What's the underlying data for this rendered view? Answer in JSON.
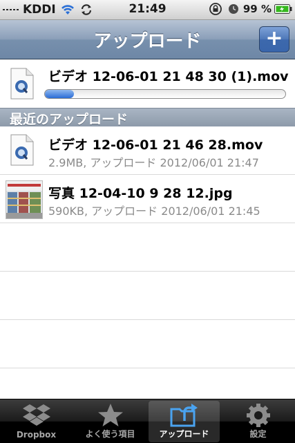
{
  "status_bar": {
    "carrier": "KDDI",
    "time": "21:49",
    "battery": "99 %"
  },
  "nav": {
    "title": "アップロード",
    "add_label": "+"
  },
  "current_upload": {
    "file_name": "ビデオ 12-06-01 21 48 30 (1).mov",
    "progress": 0.12,
    "icon": "quicktime-file-icon"
  },
  "recent_section": {
    "header": "最近のアップロード",
    "items": [
      {
        "title": "ビデオ 12-06-01 21 46 28.mov",
        "detail": "2.9MB, アップロード 2012/06/01 21:47",
        "icon": "quicktime-file-icon"
      },
      {
        "title": "写真 12-04-10 9 28 12.jpg",
        "detail": "590KB, アップロード 2012/06/01 21:45",
        "icon": "photo-thumbnail"
      }
    ]
  },
  "tab_bar": {
    "tabs": [
      {
        "label": "Dropbox",
        "icon": "dropbox-icon",
        "active": false
      },
      {
        "label": "よく使う項目",
        "icon": "star-icon",
        "active": false
      },
      {
        "label": "アップロード",
        "icon": "upload-icon",
        "active": true
      },
      {
        "label": "設定",
        "icon": "gear-icon",
        "active": false
      }
    ]
  },
  "colors": {
    "nav_bar": "#7790ad",
    "progress_fill": "#2a6cd6",
    "section_header": "#9aa6b5",
    "tab_bar": "#000000"
  }
}
